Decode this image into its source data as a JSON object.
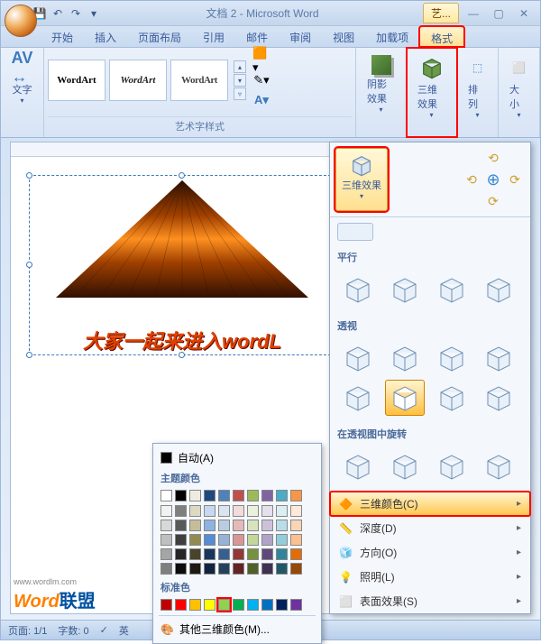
{
  "title": "文档 2 - Microsoft Word",
  "art_tools_tab": "艺...",
  "tabs": [
    "开始",
    "插入",
    "页面布局",
    "引用",
    "邮件",
    "审阅",
    "视图",
    "加载项",
    "格式"
  ],
  "active_tab": "格式",
  "ribbon": {
    "text_group": {
      "label": "文字"
    },
    "wordart_styles": {
      "label": "艺术字样式",
      "items": [
        "WordArt",
        "WordArt",
        "WordArt"
      ]
    },
    "shadow": "阴影效果",
    "threed": "三维效果",
    "arrange": "排列",
    "size": "大小"
  },
  "dropdown": {
    "head_label": "三维效果",
    "section1": "平行",
    "section2": "透视",
    "section3": "在透视图中旋转",
    "items": [
      {
        "label": "三维颜色(C)",
        "highlighted": true
      },
      {
        "label": "深度(D)"
      },
      {
        "label": "方向(O)"
      },
      {
        "label": "照明(L)"
      },
      {
        "label": "表面效果(S)"
      }
    ]
  },
  "color_popup": {
    "auto": "自动(A)",
    "theme_label": "主题颜色",
    "standard_label": "标准色",
    "more": "其他三维颜色(M)...",
    "theme_row1": [
      "#ffffff",
      "#000000",
      "#eeece1",
      "#1f497d",
      "#4f81bd",
      "#c0504d",
      "#9bbb59",
      "#8064a2",
      "#4bacc6",
      "#f79646"
    ],
    "theme_tints": [
      [
        "#f2f2f2",
        "#7f7f7f",
        "#ddd9c3",
        "#c6d9f0",
        "#dbe5f1",
        "#f2dcdb",
        "#ebf1dd",
        "#e5e0ec",
        "#dbeef3",
        "#fdeada"
      ],
      [
        "#d8d8d8",
        "#595959",
        "#c4bd97",
        "#8db3e2",
        "#b8cce4",
        "#e5b9b7",
        "#d7e3bc",
        "#ccc1d9",
        "#b7dde8",
        "#fbd5b5"
      ],
      [
        "#bfbfbf",
        "#3f3f3f",
        "#938953",
        "#548dd4",
        "#95b3d7",
        "#d99694",
        "#c3d69b",
        "#b2a2c7",
        "#92cddc",
        "#fac08f"
      ],
      [
        "#a5a5a5",
        "#262626",
        "#494429",
        "#17365d",
        "#366092",
        "#953734",
        "#76923c",
        "#5f497a",
        "#31859b",
        "#e36c09"
      ],
      [
        "#7f7f7f",
        "#0c0c0c",
        "#1d1b10",
        "#0f243e",
        "#244061",
        "#632423",
        "#4f6128",
        "#3f3151",
        "#205867",
        "#974806"
      ]
    ],
    "standard": [
      "#c00000",
      "#ff0000",
      "#ffc000",
      "#ffff00",
      "#92d050",
      "#00b050",
      "#00b0f0",
      "#0070c0",
      "#002060",
      "#7030a0"
    ]
  },
  "wordart_text": "大家一起来进入wordL",
  "statusbar": {
    "page": "页面: 1/1",
    "words": "字数: 0",
    "lang": "英"
  },
  "watermark": {
    "brand": "Word",
    "suffix": "联盟",
    "url": "www.wordlm.com"
  }
}
